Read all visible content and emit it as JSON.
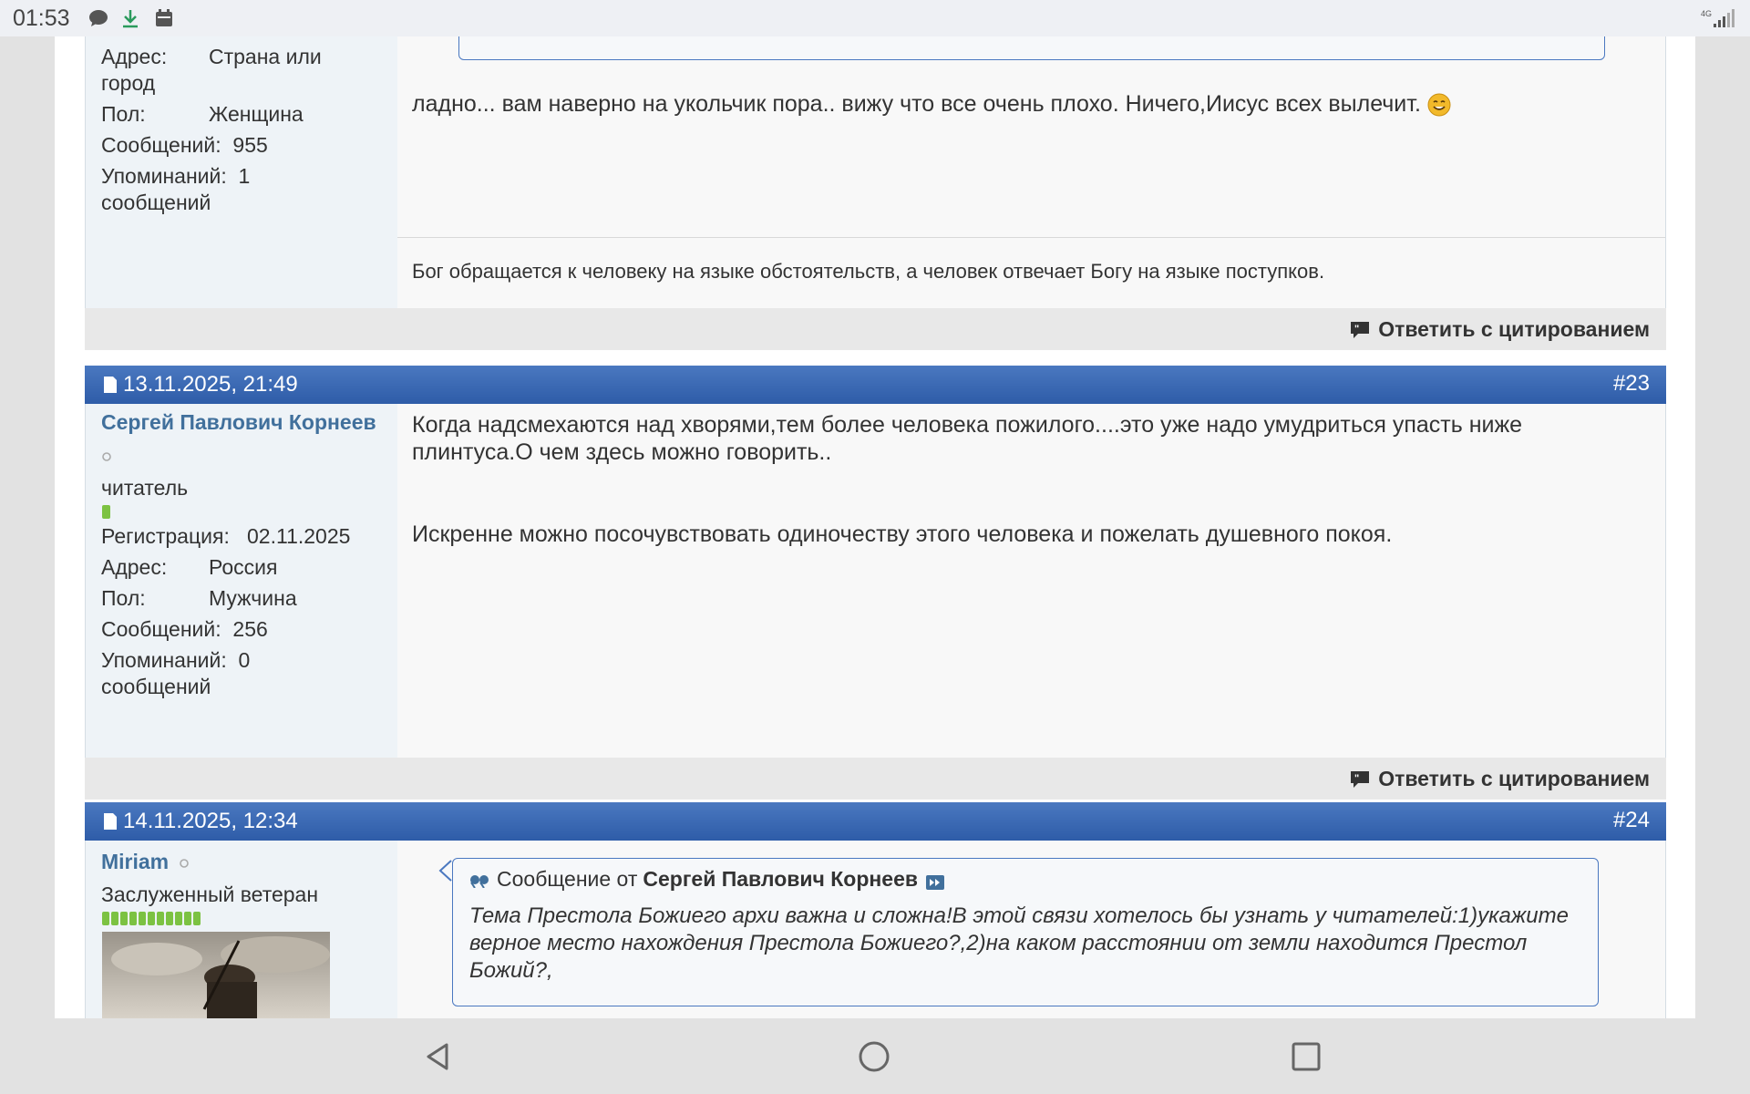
{
  "status_bar": {
    "time": "01:53",
    "icons": [
      "chat-bubble-icon",
      "download-icon",
      "calendar-icon"
    ],
    "network": "4G"
  },
  "post_prev": {
    "user_info": {
      "address_label": "Адрес:",
      "address_value": "Страна или",
      "address_value_2": "город",
      "gender_label": "Пол:",
      "gender_value": "Женщина",
      "posts_label": "Сообщений:",
      "posts_value": "955",
      "mentions_label": "Упоминаний:",
      "mentions_value": "1",
      "mentions_suffix": "сообщений"
    },
    "message": "ладно... вам наверно на укольчик пора.. вижу что все очень плохо. Ничего,Иисус всех вылечит.",
    "signature": "Бог обращается к человеку на языке обстоятельств, а человек отвечает Богу на языке поступков.",
    "reply_quote": "Ответить с цитированием"
  },
  "post_23": {
    "date": "13.11.2025, 21:49",
    "number": "#23",
    "username": "Сергей Павлович Корнеев",
    "rank": "читатель",
    "reg_label": "Регистрация:",
    "reg_value": "02.11.2025",
    "address_label": "Адрес:",
    "address_value": "Россия",
    "gender_label": "Пол:",
    "gender_value": "Мужчина",
    "posts_label": "Сообщений:",
    "posts_value": "256",
    "mentions_label": "Упоминаний:",
    "mentions_value": "0",
    "mentions_suffix": "сообщений",
    "message_line1": "Когда надсмехаются над хворями,тем более человека пожилого....это уже надо умудриться упасть ниже",
    "message_line2": "плинтуса.О чем здесь можно говорить..",
    "message_para2": "Искренне можно посочувствовать одиночеству этого человека и пожелать душевного покоя.",
    "reply_quote": "Ответить с цитированием"
  },
  "post_24": {
    "date": "14.11.2025, 12:34",
    "number": "#24",
    "username": "Miriam",
    "rank": "Заслуженный ветеран",
    "quote_prefix": "Сообщение от",
    "quote_author": "Сергей Павлович Корнеев",
    "quote_line1": "Тема Престола Божиего архи важна и сложна!В этой связи хотелось бы узнать у читателей:1)укажите",
    "quote_line2": "верное место нахождения Престола Божиего?,2)на каком расстоянии от земли находится Престол",
    "quote_line3": "Божий?,"
  },
  "colors": {
    "header_blue": "#3a68b4",
    "username_blue": "#41709c",
    "userinfo_bg": "#eef3f7",
    "reputation_green": "#7cc242"
  },
  "navigation_bar": [
    "back-icon",
    "home-icon",
    "recents-icon"
  ]
}
